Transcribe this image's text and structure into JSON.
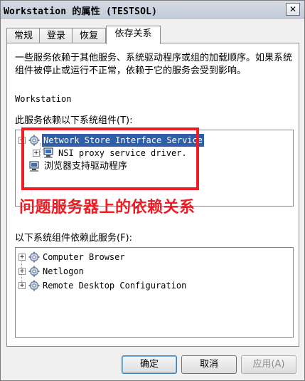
{
  "window": {
    "title": "Workstation 的属性 (TESTSOL)",
    "close_label": "✕"
  },
  "tabs": [
    {
      "label": "常规"
    },
    {
      "label": "登录"
    },
    {
      "label": "恢复"
    },
    {
      "label": "依存关系"
    }
  ],
  "panel": {
    "description": "一些服务依赖于其他服务、系统驱动程序或组的加载顺序。如果系统组件被停止或运行不正常，依赖于它的服务会受到影响。",
    "service_name": "Workstation",
    "depends_on_label": "此服务依赖以下系统组件(T):",
    "depended_by_label": "以下系统组件依赖此服务(F):"
  },
  "depends_on_tree": [
    {
      "label": "Network Store Interface Service",
      "expander": "−",
      "icon": "gear-icon",
      "selected": true
    },
    {
      "label": "NSI proxy service driver.",
      "expander": "+",
      "icon": "computer-icon"
    },
    {
      "label": "浏览器支持驱动程序",
      "icon": "computer-icon"
    }
  ],
  "depended_by_tree": [
    {
      "label": "Computer Browser",
      "expander": "+",
      "icon": "gear-icon"
    },
    {
      "label": "Netlogon",
      "expander": "+",
      "icon": "gear-icon"
    },
    {
      "label": "Remote Desktop Configuration",
      "expander": "+",
      "icon": "gear-icon"
    }
  ],
  "annotation": {
    "text": "问题服务器上的依赖关系",
    "color": "#ee1c25"
  },
  "buttons": {
    "ok": "确定",
    "cancel": "取消",
    "apply": "应用(A)"
  }
}
